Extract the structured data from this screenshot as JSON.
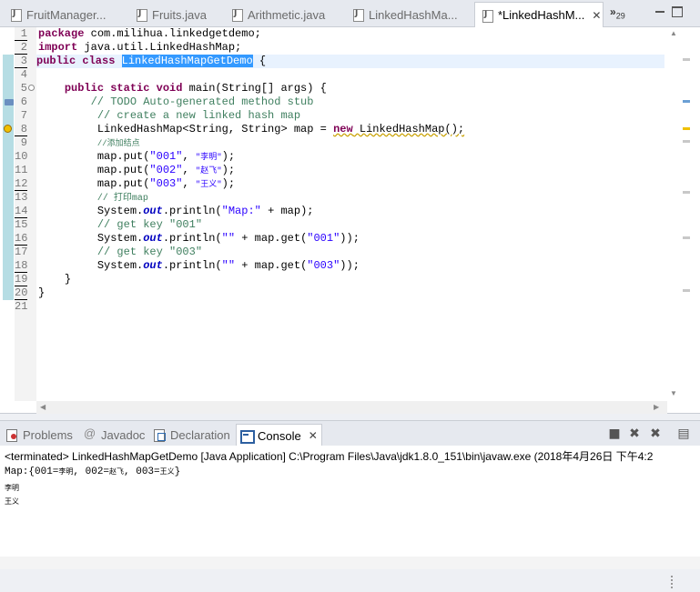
{
  "editor_tabs": [
    {
      "label": "FruitManager...",
      "active": false
    },
    {
      "label": "Fruits.java",
      "active": false
    },
    {
      "label": "Arithmetic.java",
      "active": false
    },
    {
      "label": "LinkedHashMa...",
      "active": false
    },
    {
      "label": "*LinkedHashM...",
      "active": true
    }
  ],
  "tab_overflow": {
    "symbol": "»",
    "count": "29"
  },
  "line_numbers": [
    "1",
    "2",
    "3",
    "4",
    "5",
    "6",
    "7",
    "8",
    "9",
    "10",
    "11",
    "12",
    "13",
    "14",
    "15",
    "16",
    "17",
    "18",
    "19",
    "20",
    "21"
  ],
  "code": {
    "l1_kw": "package",
    "l1_rest": " com.milihua.linkedgetdemo;",
    "l2_kw": "import",
    "l2_rest": " java.util.LinkedHashMap;",
    "l3_kw": "public class",
    "l3_sel": "LinkedHashMapGetDemo",
    "l3_rest": " {",
    "l5_kw": "public static void",
    "l5_rest": " main(String[] args) {",
    "l6": "// TODO Auto-generated method stub",
    "l7": "// create a new linked hash map",
    "l8_a": "LinkedHashMap<String, String> map = ",
    "l8_kw": "new",
    "l8_b": " LinkedHashMap();",
    "l9": "//添加结点",
    "l10_a": "map.put(",
    "l10_s1": "\"001\"",
    "l10_s2": "\"李明\"",
    "l10_b": ");",
    "l11_a": "map.put(",
    "l11_s1": "\"002\"",
    "l11_s2": "\"赵飞\"",
    "l11_b": ");",
    "l12_a": "map.put(",
    "l12_s1": "\"003\"",
    "l12_s2": "\"王义\"",
    "l12_b": ");",
    "l13": "// 打印map",
    "l14_a": "System.",
    "l14_f": "out",
    "l14_b": ".println(",
    "l14_s": "\"Map:\"",
    "l14_c": " + map);",
    "l15": "// get key \"001\"",
    "l16_a": "System.",
    "l16_f": "out",
    "l16_b": ".println(",
    "l16_s": "\"\"",
    "l16_c": " + map.get(",
    "l16_s2": "\"001\"",
    "l16_d": "));",
    "l17": "// get key \"003\"",
    "l18_a": "System.",
    "l18_f": "out",
    "l18_b": ".println(",
    "l18_s": "\"\"",
    "l18_c": " + map.get(",
    "l18_s2": "\"003\"",
    "l18_d": "));",
    "l19": "}",
    "l20": "}"
  },
  "view_tabs": [
    {
      "label": "Problems",
      "active": false
    },
    {
      "label": "Javadoc",
      "active": false
    },
    {
      "label": "Declaration",
      "active": false
    },
    {
      "label": "Console",
      "active": true
    }
  ],
  "console": {
    "header": "<terminated> LinkedHashMapGetDemo [Java Application] C:\\Program Files\\Java\\jdk1.8.0_151\\bin\\javaw.exe (2018年4月26日 下午4:2",
    "out1_a": "Map:{001=",
    "out1_v1": "李明",
    "out1_b": ", 002=",
    "out1_v2": "赵飞",
    "out1_c": ", 003=",
    "out1_v3": "王义",
    "out1_d": "}",
    "out2": "李明",
    "out3": "王义"
  },
  "colors": {
    "keyword": "#7f0055",
    "comment": "#3f7f5f",
    "string": "#2a00ff",
    "field": "#0000c0",
    "selection": "#3399ff"
  }
}
